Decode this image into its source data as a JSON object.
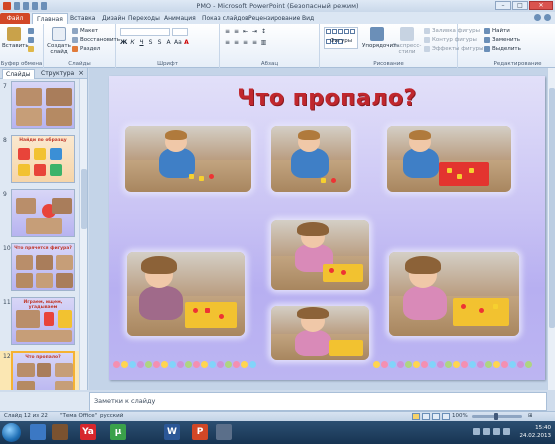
{
  "window": {
    "title": "РМО - Microsoft PowerPoint (Безопасный режим)",
    "controls": [
      "–",
      "□",
      "✕"
    ]
  },
  "tabs": [
    "Файл",
    "Главная",
    "Вставка",
    "Дизайн",
    "Переходы",
    "Анимация",
    "Показ слайдов",
    "Рецензирование",
    "Вид"
  ],
  "ribbon": {
    "clipboard": {
      "paste": "Вставить",
      "label": "Буфер обмена"
    },
    "slides": {
      "new_slide": "Создать слайд",
      "layout": "Макет",
      "reset": "Восстановить",
      "section": "Раздел",
      "label": "Слайды"
    },
    "font": {
      "label": "Шрифт"
    },
    "paragraph": {
      "label": "Абзац"
    },
    "drawing": {
      "shapes": "Фигуры",
      "arrange": "Упорядочить",
      "quick_styles": "Экспресс-стили",
      "fill": "Заливка фигуры",
      "outline": "Контур фигуры",
      "effects": "Эффекты фигуры",
      "label": "Рисование"
    },
    "editing": {
      "find": "Найти",
      "replace": "Заменить",
      "select": "Выделить",
      "label": "Редактирование"
    }
  },
  "panel": {
    "tab_slides": "Слайды",
    "tab_outline": "Структура",
    "close": "×",
    "thumbnails": [
      {
        "num": "7",
        "title": ""
      },
      {
        "num": "8",
        "title": "Найди по образцу"
      },
      {
        "num": "9",
        "title": ""
      },
      {
        "num": "10",
        "title": "Что прячется фигура?"
      },
      {
        "num": "11",
        "title": "Играем, ищем, угадываем"
      },
      {
        "num": "12",
        "title": "Что пропало?"
      }
    ]
  },
  "slide": {
    "title": "Что пропало?"
  },
  "notes": {
    "placeholder": "Заметки к слайду"
  },
  "status": {
    "slide": "Слайд 12 из 22",
    "theme": "\"Тема Office\"",
    "language": "русский",
    "zoom": "100%"
  },
  "taskbar": {
    "apps": [
      "Ya",
      "µ",
      "W",
      "P"
    ],
    "clock_time": "15:40",
    "clock_date": "24.02.2013"
  },
  "colors": {
    "accent_file_tab": "#d24726",
    "slide_title": "#c0272d",
    "taskbar": "#173452"
  }
}
